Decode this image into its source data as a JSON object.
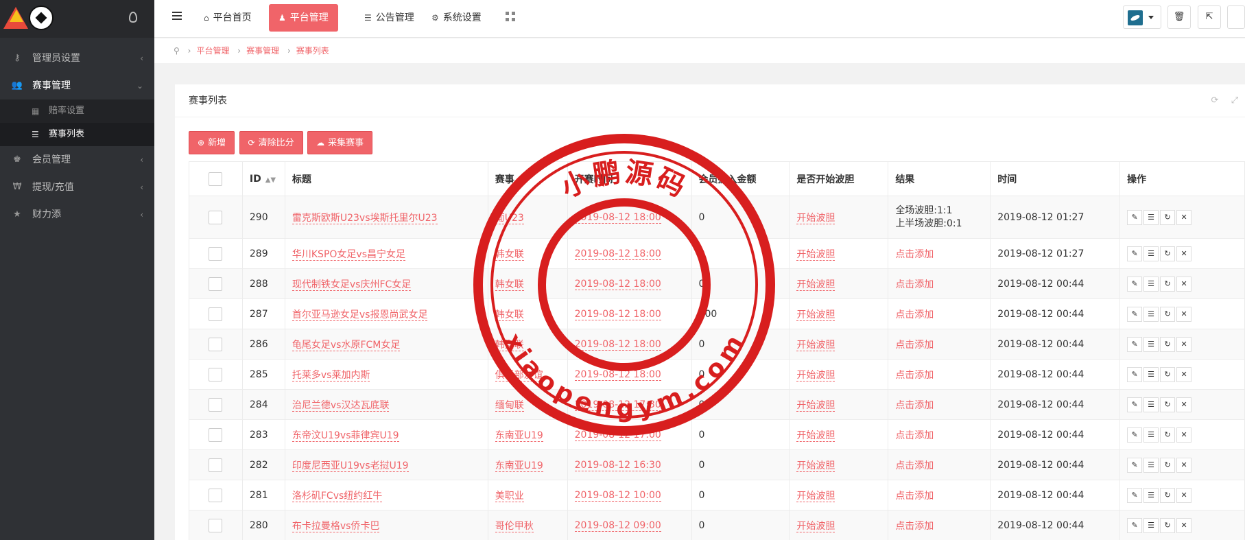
{
  "colors": {
    "accent": "#f06469",
    "sidebar_bg": "#2f3135",
    "stamp_red": "#d81e1e"
  },
  "sidebar": {
    "items": [
      {
        "label": "管理员设置",
        "icon": "key-icon",
        "glyph": "⚷"
      },
      {
        "label": "赛事管理",
        "icon": "users-icon",
        "glyph": "👥"
      },
      {
        "label": "会员管理",
        "icon": "trophy-icon",
        "glyph": "♚"
      },
      {
        "label": "提现/充值",
        "icon": "won-icon",
        "glyph": "₩"
      },
      {
        "label": "财力添",
        "icon": "star-icon",
        "glyph": "★"
      }
    ],
    "subitems": [
      {
        "label": "赔率设置",
        "icon": "grid-icon",
        "glyph": "▦"
      },
      {
        "label": "赛事列表",
        "icon": "list-icon",
        "glyph": "☰"
      }
    ]
  },
  "topbar": {
    "tabs": [
      {
        "label": "平台首页",
        "icon": "home-icon",
        "glyph": "⌂"
      },
      {
        "label": "平台管理",
        "icon": "user-icon",
        "glyph": "♟"
      },
      {
        "label": "公告管理",
        "icon": "list-icon",
        "glyph": "☰"
      },
      {
        "label": "系统设置",
        "icon": "gear-icon",
        "glyph": "⚙"
      }
    ],
    "trash_glyph": "🗑",
    "external_glyph": "⇱"
  },
  "breadcrumb": {
    "items": [
      "平台管理",
      "赛事管理",
      "赛事列表"
    ]
  },
  "panel": {
    "title": "赛事列表",
    "buttons": [
      {
        "label": "新增",
        "icon": "plus-circle-icon",
        "glyph": "⊕"
      },
      {
        "label": "清除比分",
        "icon": "refresh-icon",
        "glyph": "⟳"
      },
      {
        "label": "采集赛事",
        "icon": "cloud-download-icon",
        "glyph": "☁"
      }
    ]
  },
  "table": {
    "headers": [
      "ID",
      "标题",
      "赛事",
      "开赛时间",
      "会员投入金额",
      "是否开始波胆",
      "结果",
      "时间",
      "操作"
    ],
    "rows": [
      {
        "id": "290",
        "title": "雷克斯欧斯U23vs埃斯托里尔U23",
        "league": "葡U23",
        "start": "2019-08-12 18:00",
        "amount": "0",
        "bet": "开始波胆",
        "result": "全场波胆:1:1",
        "result2": "上半场波胆:0:1",
        "time": "2019-08-12 01:27"
      },
      {
        "id": "289",
        "title": "华川KSPO女足vs昌宁女足",
        "league": "韩女联",
        "start": "2019-08-12 18:00",
        "amount": "0",
        "bet": "开始波胆",
        "result": "点击添加",
        "time": "2019-08-12 01:27"
      },
      {
        "id": "288",
        "title": "现代制铁女足vs庆州FC女足",
        "league": "韩女联",
        "start": "2019-08-12 18:00",
        "amount": "0",
        "bet": "开始波胆",
        "result": "点击添加",
        "time": "2019-08-12 00:44"
      },
      {
        "id": "287",
        "title": "首尔亚马逊女足vs报恩尚武女足",
        "league": "韩女联",
        "start": "2019-08-12 18:00",
        "amount": "100",
        "bet": "开始波胆",
        "result": "点击添加",
        "time": "2019-08-12 00:44"
      },
      {
        "id": "286",
        "title": "龟尾女足vs水原FCM女足",
        "league": "韩女联",
        "start": "2019-08-12 18:00",
        "amount": "0",
        "bet": "开始波胆",
        "result": "点击添加",
        "time": "2019-08-12 00:44"
      },
      {
        "id": "285",
        "title": "托莱多vs莱加内斯",
        "league": "俱乐部友谊",
        "start": "2019-08-12 18:00",
        "amount": "0",
        "bet": "开始波胆",
        "result": "点击添加",
        "time": "2019-08-12 00:44"
      },
      {
        "id": "284",
        "title": "治尼兰德vs汉达瓦底联",
        "league": "缅甸联",
        "start": "2019-08-12 17:30",
        "amount": "0",
        "bet": "开始波胆",
        "result": "点击添加",
        "time": "2019-08-12 00:44"
      },
      {
        "id": "283",
        "title": "东帝汶U19vs菲律宾U19",
        "league": "东南亚U19",
        "start": "2019-08-12 17:00",
        "amount": "0",
        "bet": "开始波胆",
        "result": "点击添加",
        "time": "2019-08-12 00:44"
      },
      {
        "id": "282",
        "title": "印度尼西亚U19vs老挝U19",
        "league": "东南亚U19",
        "start": "2019-08-12 16:30",
        "amount": "0",
        "bet": "开始波胆",
        "result": "点击添加",
        "time": "2019-08-12 00:44"
      },
      {
        "id": "281",
        "title": "洛杉矶FCvs纽约红牛",
        "league": "美职业",
        "start": "2019-08-12 10:00",
        "amount": "0",
        "bet": "开始波胆",
        "result": "点击添加",
        "time": "2019-08-12 00:44"
      },
      {
        "id": "280",
        "title": "布卡拉曼格vs侨卡巴",
        "league": "哥伦甲秋",
        "start": "2019-08-12 09:00",
        "amount": "0",
        "bet": "开始波胆",
        "result": "点击添加",
        "time": "2019-08-12 00:44"
      }
    ]
  },
  "watermark": {
    "top_text": "小鹏源码",
    "bottom_text": "xiaopengym.com"
  }
}
